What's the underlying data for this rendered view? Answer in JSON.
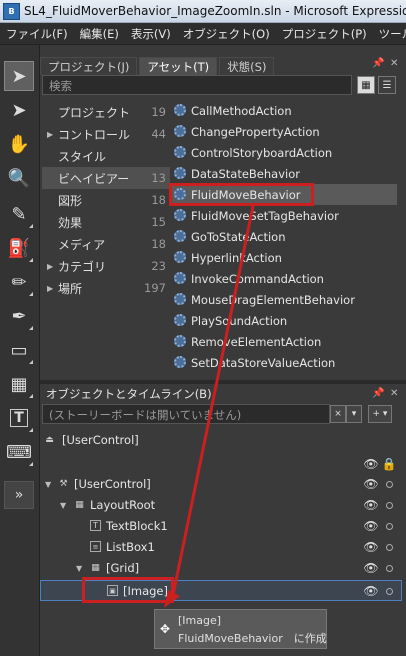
{
  "window": {
    "title": "SL4_FluidMoverBehavior_ImageZoomIn.sln - Microsoft Expressio",
    "icon_text": "B"
  },
  "menu": [
    "ファイル(F)",
    "編集(E)",
    "表示(V)",
    "オブジェクト(O)",
    "プロジェクト(P)",
    "ツール"
  ],
  "tools": [
    {
      "icon": "selection-arrow-icon",
      "glyph": "➤"
    },
    {
      "icon": "direct-selection-icon",
      "glyph": "➤"
    },
    {
      "icon": "pan-hand-icon",
      "glyph": "✋"
    },
    {
      "icon": "zoom-icon",
      "glyph": "🔍"
    },
    {
      "icon": "eyedropper-icon",
      "glyph": "✎"
    },
    {
      "icon": "paint-bucket-icon",
      "glyph": "⛽"
    },
    {
      "icon": "pencil-icon",
      "glyph": "✏"
    },
    {
      "icon": "pen-icon",
      "glyph": "✒"
    },
    {
      "icon": "rectangle-icon",
      "glyph": "▭"
    },
    {
      "icon": "grid-icon",
      "glyph": "▦"
    },
    {
      "icon": "textblock-icon",
      "glyph": "T"
    },
    {
      "icon": "control-icon",
      "glyph": "⌨"
    }
  ],
  "assets_panel": {
    "tabs": [
      "プロジェクト(J)",
      "アセット(T)",
      "状態(S)"
    ],
    "active_tab": 1,
    "search_placeholder": "検索",
    "categories": [
      {
        "label": "プロジェクト",
        "count": "19",
        "expandable": false
      },
      {
        "label": "コントロール",
        "count": "44",
        "expandable": true
      },
      {
        "label": "スタイル",
        "count": "",
        "expandable": false
      },
      {
        "label": "ビヘイビアー",
        "count": "13",
        "expandable": false,
        "selected": true
      },
      {
        "label": "図形",
        "count": "18",
        "expandable": false
      },
      {
        "label": "効果",
        "count": "15",
        "expandable": false
      },
      {
        "label": "メディア",
        "count": "18",
        "expandable": false
      },
      {
        "label": "カテゴリ",
        "count": "23",
        "expandable": true
      },
      {
        "label": "場所",
        "count": "197",
        "expandable": true
      }
    ],
    "behaviors": [
      "CallMethodAction",
      "ChangePropertyAction",
      "ControlStoryboardAction",
      "DataStateBehavior",
      "FluidMoveBehavior",
      "FluidMoveSetTagBehavior",
      "GoToStateAction",
      "HyperlinkAction",
      "InvokeCommandAction",
      "MouseDragElementBehavior",
      "PlaySoundAction",
      "RemoveElementAction",
      "SetDataStoreValueAction"
    ],
    "selected_behavior": 4
  },
  "objects_panel": {
    "title": "オブジェクトとタイムライン(B)",
    "storyboard_text": "(ストーリーボードは開いていません)",
    "scope": "[UserControl]",
    "tree": [
      {
        "label": "[UserControl]",
        "icon": "usercontrol-icon"
      },
      {
        "label": "LayoutRoot",
        "icon": "grid-panel-icon"
      },
      {
        "label": "TextBlock1",
        "icon": "textblock-node-icon"
      },
      {
        "label": "ListBox1",
        "icon": "listbox-node-icon"
      },
      {
        "label": "[Grid]",
        "icon": "grid-panel-icon"
      },
      {
        "label": "[Image]",
        "icon": "image-node-icon"
      }
    ]
  },
  "tooltip": {
    "line1": "[Image]",
    "line2": "FluidMoveBehavior　に作成"
  },
  "colors": {
    "highlight_red": "#cc1f1f",
    "selection_blue": "#4e7fc3"
  }
}
